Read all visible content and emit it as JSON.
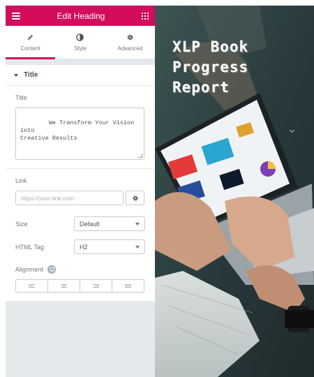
{
  "header": {
    "title": "Edit Heading"
  },
  "tabs": [
    {
      "label": "Content",
      "icon": "pencil-icon",
      "active": true
    },
    {
      "label": "Style",
      "icon": "contrast-icon",
      "active": false
    },
    {
      "label": "Advanced",
      "icon": "gear-icon",
      "active": false
    }
  ],
  "section": {
    "label": "Title"
  },
  "title_control": {
    "label": "Title",
    "value": "We Transform Your Vision into\nCreative Results"
  },
  "link_control": {
    "label": "Link",
    "placeholder": "https://your-link.com"
  },
  "size_control": {
    "label": "Size",
    "value": "Default"
  },
  "html_tag_control": {
    "label": "HTML Tag",
    "value": "H2"
  },
  "alignment_control": {
    "label": "Alignment",
    "options": [
      "left",
      "center",
      "right",
      "justify"
    ]
  },
  "preview": {
    "heading": "XLP Book\nProgress\nReport"
  },
  "colors": {
    "accent": "#d30c5c",
    "panel_bg": "#e6e9ec"
  }
}
